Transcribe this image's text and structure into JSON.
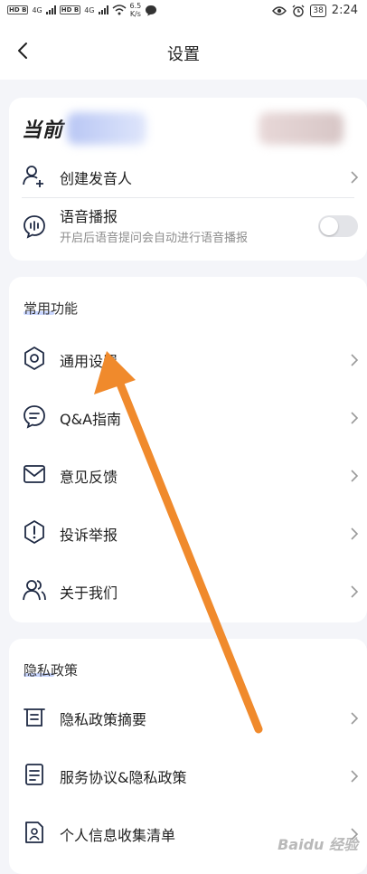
{
  "status_bar": {
    "hd1": "HD B",
    "net1": "4G",
    "hd2": "HD B",
    "net2": "4G",
    "speed_value": "6.5",
    "speed_unit": "K/s",
    "battery": "38",
    "time": "2:24"
  },
  "nav": {
    "title": "设置"
  },
  "account": {
    "current_label": "当前",
    "create_speaker": "创建发音人",
    "voice_broadcast": "语音播报",
    "voice_broadcast_hint": "开启后语音提问会自动进行语音播报",
    "voice_broadcast_enabled": false
  },
  "common": {
    "title": "常用功能",
    "items": [
      {
        "label": "通用设置"
      },
      {
        "label": "Q&A指南"
      },
      {
        "label": "意见反馈"
      },
      {
        "label": "投诉举报"
      },
      {
        "label": "关于我们"
      }
    ]
  },
  "privacy": {
    "title": "隐私政策",
    "items": [
      {
        "label": "隐私政策摘要"
      },
      {
        "label": "服务协议&隐私政策"
      },
      {
        "label": "个人信息收集清单"
      }
    ]
  },
  "watermark": "Baidu 经验",
  "colors": {
    "accent_arrow": "#f08a2c",
    "background": "#f4f5f9"
  }
}
